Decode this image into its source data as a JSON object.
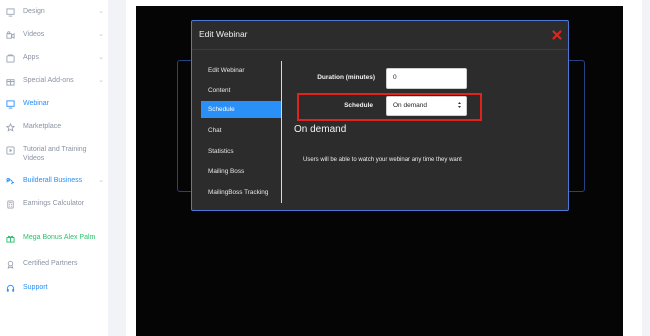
{
  "sidebar": {
    "items": [
      {
        "label": "Design",
        "icon": "design-icon",
        "chevron": true,
        "state": "normal"
      },
      {
        "label": "Videos",
        "icon": "video-icon",
        "chevron": true,
        "state": "normal"
      },
      {
        "label": "Apps",
        "icon": "apps-icon",
        "chevron": true,
        "state": "normal"
      },
      {
        "label": "Special Add-ons",
        "icon": "addons-icon",
        "chevron": true,
        "state": "normal"
      },
      {
        "label": "Webinar",
        "icon": "webinar-icon",
        "chevron": false,
        "state": "active"
      },
      {
        "label": "Marketplace",
        "icon": "star-icon",
        "chevron": false,
        "state": "normal"
      },
      {
        "label": "Tutorial and Training Videos",
        "icon": "tutorial-icon",
        "chevron": false,
        "state": "normal"
      },
      {
        "label": "Builderall Business",
        "icon": "business-icon",
        "chevron": true,
        "state": "active"
      },
      {
        "label": "Earnings Calculator",
        "icon": "calculator-icon",
        "chevron": false,
        "state": "normal"
      },
      {
        "label": "Mega Bonus Alex Palm",
        "icon": "bonus-icon",
        "chevron": false,
        "state": "green"
      },
      {
        "label": "Certified Partners",
        "icon": "partners-icon",
        "chevron": false,
        "state": "normal"
      },
      {
        "label": "Support",
        "icon": "support-icon",
        "chevron": false,
        "state": "active"
      }
    ],
    "chevron_glyph": "⌄"
  },
  "modal": {
    "title": "Edit Webinar",
    "nav": [
      "Edit Webinar",
      "Content",
      "Schedule",
      "Chat",
      "Statistics",
      "Mailing Boss",
      "MailingBoss Tracking"
    ],
    "selected_index": 2,
    "duration_label": "Duration (minutes)",
    "duration_value": "0",
    "schedule_label": "Schedule",
    "schedule_value": "On demand",
    "section_heading": "On demand",
    "description": "Users will be able to watch your webinar any time they want"
  },
  "colors": {
    "accent": "#2a8ff7",
    "green": "#2bbf6b",
    "close": "#e0231c",
    "highlight": "#e0231c",
    "modal_bg": "#2c2c2c",
    "modal_border": "#4e78d8"
  }
}
